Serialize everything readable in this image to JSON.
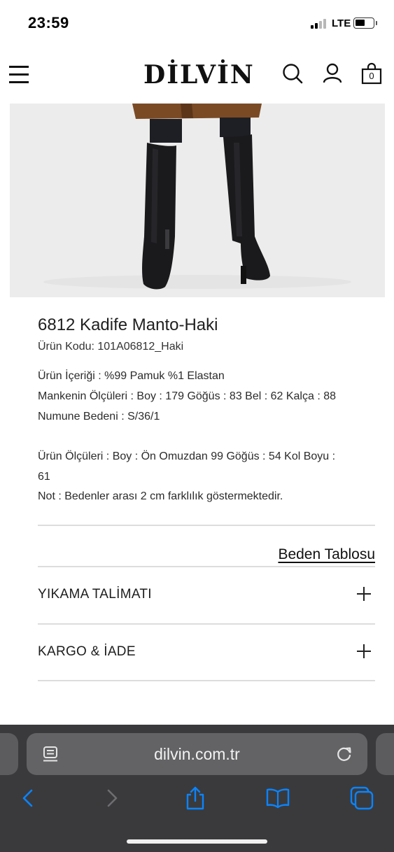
{
  "status_bar": {
    "time": "23:59",
    "network": "LTE"
  },
  "header": {
    "logo": "DİLVİN",
    "cart_count": "0"
  },
  "product": {
    "title": "6812 Kadife Manto-Haki",
    "code": "Ürün Kodu: 101A06812_Haki",
    "content": "Ürün İçeriği : %99 Pamuk %1 Elastan",
    "model_measurements": "Mankenin Ölçüleri : Boy : 179 Göğüs : 83 Bel : 62 Kalça : 88",
    "sample_size": "Numune Bedeni : S/36/1",
    "product_measurements_line1": "Ürün Ölçüleri : Boy : Ön Omuzdan 99 Göğüs : 54 Kol Boyu :",
    "product_measurements_line2": "61",
    "note": "Not : Bedenler arası 2 cm farklılık göstermektedir."
  },
  "size_chart_link": "Beden Tablosu",
  "accordions": [
    {
      "label": "YIKAMA TALİMATI"
    },
    {
      "label": "KARGO & İADE"
    }
  ],
  "browser": {
    "url": "dilvin.com.tr"
  },
  "colors": {
    "boot_black": "#1a1a1c",
    "coat_brown": "#7a4a25",
    "safari_bar": "#3a3a3c",
    "safari_blue": "#0a84ff"
  }
}
